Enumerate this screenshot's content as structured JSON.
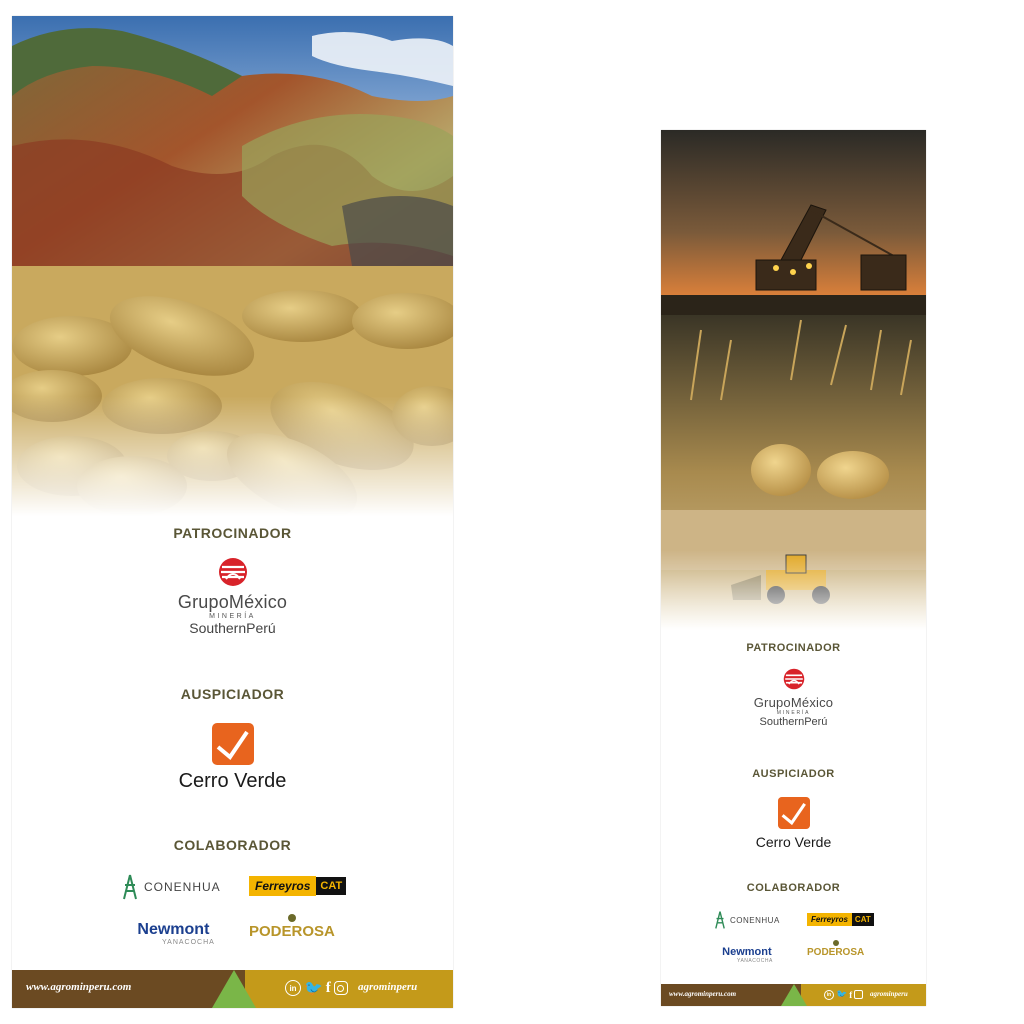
{
  "banners": [
    {
      "id": "large",
      "sections": {
        "sponsor_title": "PATROCINADOR",
        "supporter_title": "AUSPICIADOR",
        "collaborator_title": "COLABORADOR"
      },
      "sponsor": {
        "name": "GrupoMéxico",
        "sub": "MINERÍA",
        "unit": "SouthernPerú"
      },
      "supporter": {
        "name": "Cerro Verde"
      },
      "collaborators": {
        "conenhua": "CONENHUA",
        "ferreyros": "Ferreyros",
        "cat": "CAT",
        "newmont": "Newmont",
        "newmont_sub": "YANACOCHA",
        "poderosa": "PODEROSA"
      },
      "footer": {
        "url": "www.agrominperu.com",
        "handle": "agrominperu"
      }
    },
    {
      "id": "small",
      "sections": {
        "sponsor_title": "PATROCINADOR",
        "supporter_title": "AUSPICIADOR",
        "collaborator_title": "COLABORADOR"
      },
      "sponsor": {
        "name": "GrupoMéxico",
        "sub": "MINERÍA",
        "unit": "SouthernPerú"
      },
      "supporter": {
        "name": "Cerro Verde"
      },
      "collaborators": {
        "conenhua": "CONENHUA",
        "ferreyros": "Ferreyros",
        "cat": "CAT",
        "newmont": "Newmont",
        "newmont_sub": "YANACOCHA",
        "poderosa": "PODEROSA"
      },
      "footer": {
        "url": "www.agrominperu.com",
        "handle": "agrominperu"
      }
    }
  ],
  "colors": {
    "section_title": "#5a5636",
    "footer_brown": "#6b4a22",
    "footer_gold": "#c49a1a",
    "footer_triangle": "#7ab648",
    "grupo_red": "#d8232a",
    "cerro_orange": "#e8641e",
    "ferreyros_yellow": "#f4b400",
    "newmont_blue": "#1b3f8f",
    "poderosa_gold": "#b8952a",
    "conenhua_green": "#2e8b57"
  },
  "icons": [
    "linkedin-icon",
    "twitter-icon",
    "facebook-icon",
    "instagram-icon"
  ]
}
